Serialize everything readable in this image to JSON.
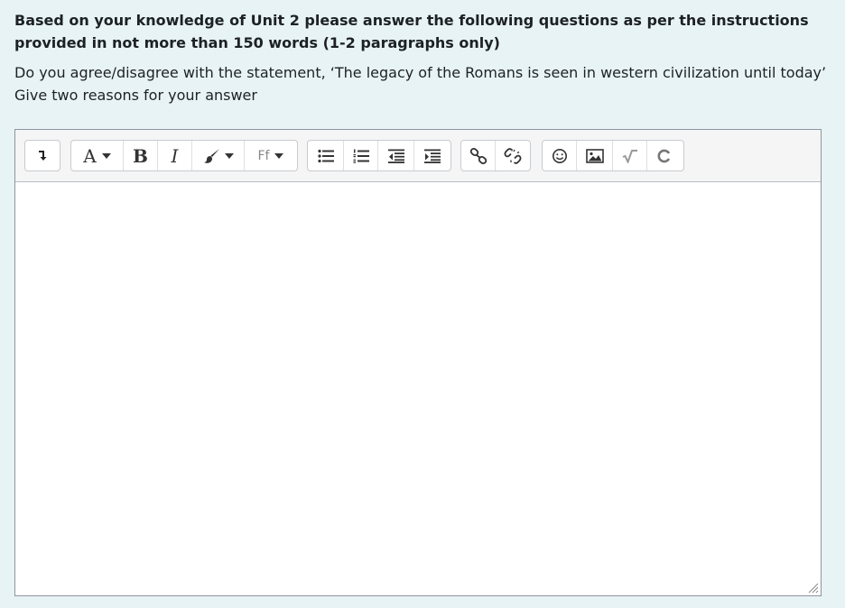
{
  "question": {
    "instruction": "Based on your knowledge of Unit 2 please answer the following questions as per the instructions provided in not more than 150 words (1-2 paragraphs only)",
    "statement": "Do you agree/disagree with the statement, ‘The legacy of the Romans is seen in western civilization until  today’ Give two reasons for your answer"
  },
  "toolbar": {
    "font_size_label": "A",
    "bold_label": "B",
    "italic_label": "I",
    "font_family_label": "Ff"
  },
  "editor": {
    "content": ""
  },
  "colors": {
    "page_bg": "#e7f3f5",
    "toolbar_bg": "#f5f5f5",
    "border": "#8f959e"
  }
}
